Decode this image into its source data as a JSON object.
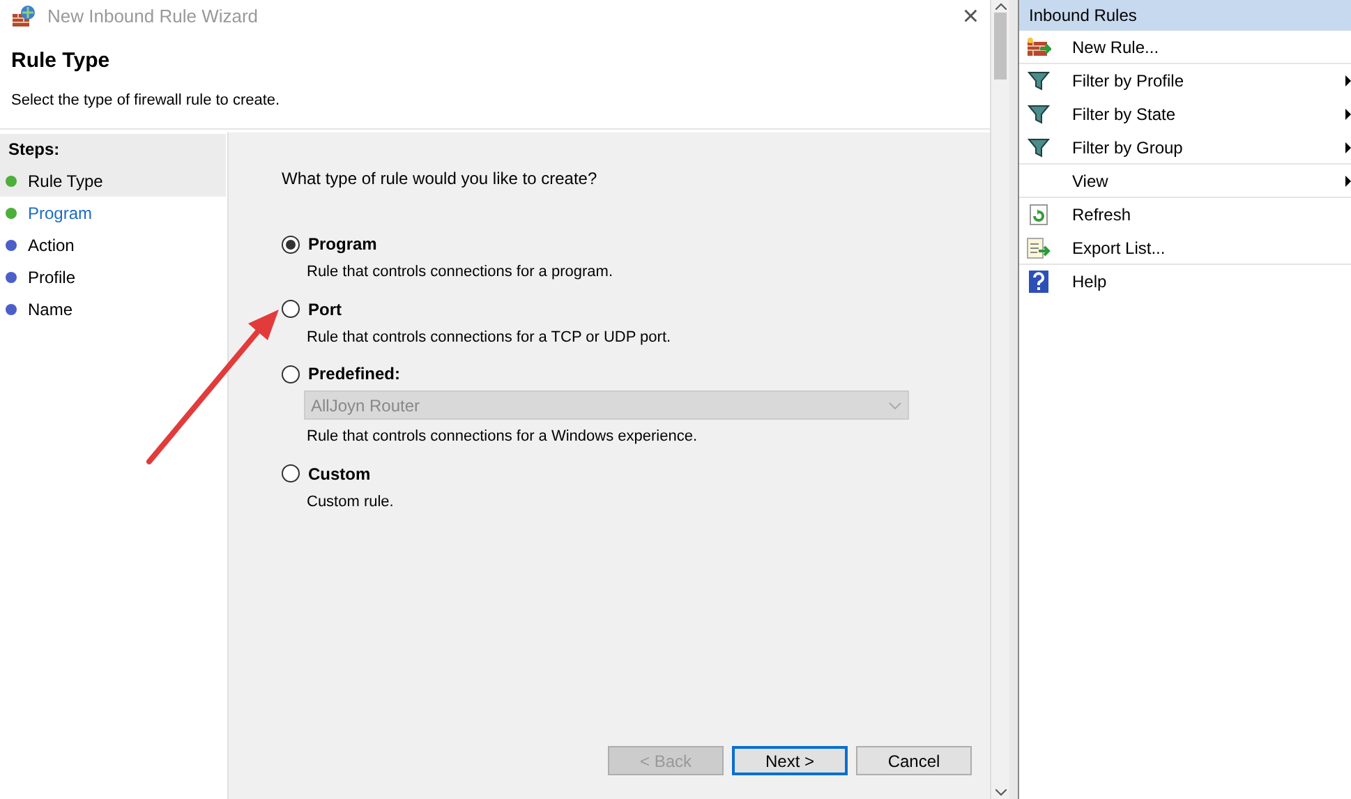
{
  "window": {
    "title": "New Inbound Rule Wizard",
    "close": "×"
  },
  "header": {
    "title": "Rule Type",
    "subtitle": "Select the type of firewall rule to create."
  },
  "steps": {
    "title": "Steps:",
    "items": [
      {
        "label": "Rule Type",
        "selected": true,
        "kind": "plain",
        "color": "#4caf3a"
      },
      {
        "label": "Program",
        "selected": false,
        "kind": "link",
        "color": "#4caf3a"
      },
      {
        "label": "Action",
        "selected": false,
        "kind": "plain",
        "color": "#4a5fc8"
      },
      {
        "label": "Profile",
        "selected": false,
        "kind": "plain",
        "color": "#4a5fc8"
      },
      {
        "label": "Name",
        "selected": false,
        "kind": "plain",
        "color": "#4a5fc8"
      }
    ]
  },
  "question": "What type of rule would you like to create?",
  "options": [
    {
      "label": "Program",
      "description": "Rule that controls connections for a program.",
      "selected": true
    },
    {
      "label": "Port",
      "description": "Rule that controls connections for a TCP or UDP port.",
      "selected": false
    },
    {
      "label": "Predefined:",
      "dropdown": {
        "value": "AllJoyn Router",
        "disabled": true
      },
      "description": "Rule that controls connections for a Windows experience.",
      "selected": false
    },
    {
      "label": "Custom",
      "description": "Custom rule.",
      "selected": false
    }
  ],
  "buttons": [
    {
      "label": "< Back",
      "disabled": true,
      "default": false
    },
    {
      "label": "Next >",
      "disabled": false,
      "default": true
    },
    {
      "label": "Cancel",
      "disabled": false,
      "default": false
    }
  ],
  "actions": {
    "title": "Inbound Rules",
    "items": [
      {
        "label": "New Rule...",
        "kind": "new",
        "submenu": false
      },
      {
        "label": "Filter by Profile",
        "kind": "filter",
        "submenu": true
      },
      {
        "label": "Filter by State",
        "kind": "filter",
        "submenu": true
      },
      {
        "label": "Filter by Group",
        "kind": "filter",
        "submenu": true
      },
      {
        "label": "View",
        "kind": "plain",
        "submenu": true
      },
      {
        "label": "Refresh",
        "kind": "refresh",
        "submenu": false
      },
      {
        "label": "Export List...",
        "kind": "export",
        "submenu": false
      },
      {
        "label": "Help",
        "kind": "help",
        "submenu": false
      }
    ]
  }
}
